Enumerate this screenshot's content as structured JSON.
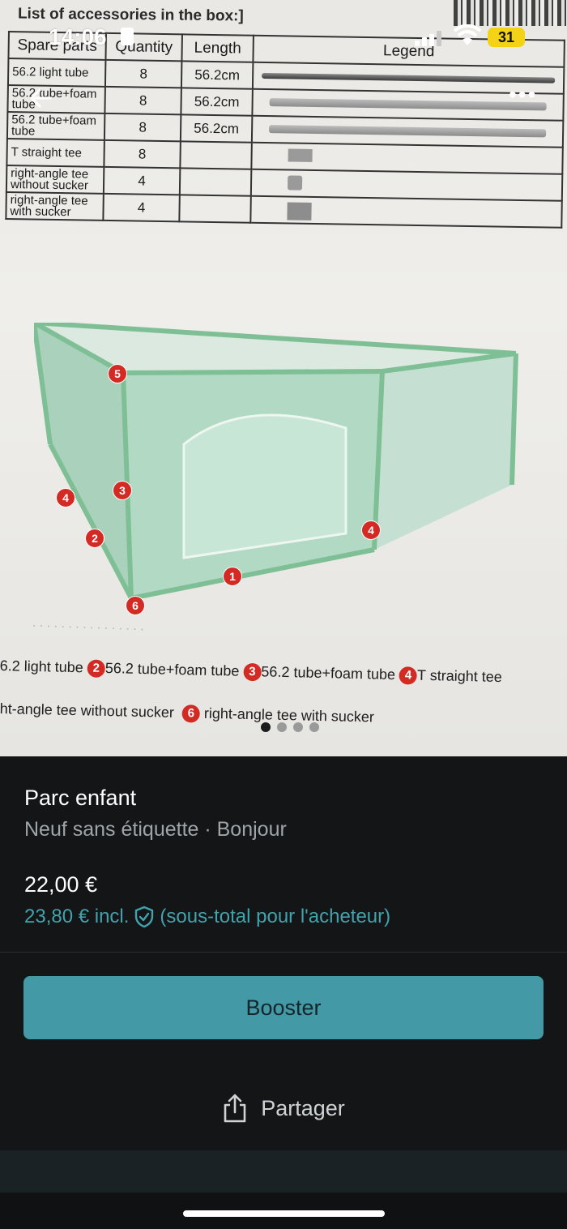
{
  "status_bar": {
    "time": "14:06",
    "battery": "31"
  },
  "photo": {
    "doc_title": "List of accessories in the box:]",
    "table": {
      "headers": [
        "Spare parts",
        "Quantity",
        "Length",
        "Legend"
      ],
      "rows": [
        {
          "part": "56.2 light tube",
          "qty": "8",
          "length": "56.2cm"
        },
        {
          "part": "56.2 tube+foam tube",
          "qty": "8",
          "length": "56.2cm"
        },
        {
          "part": "56.2 tube+foam tube",
          "qty": "8",
          "length": "56.2cm"
        },
        {
          "part": "T straight tee",
          "qty": "8",
          "length": ""
        },
        {
          "part": "right-angle tee without sucker",
          "qty": "4",
          "length": ""
        },
        {
          "part": "right-angle tee with sucker",
          "qty": "4",
          "length": ""
        }
      ]
    },
    "markers": [
      "5",
      "3",
      "4",
      "2",
      "6",
      "1",
      "4"
    ],
    "caption": {
      "line1": {
        "t1": "6.2 light tube",
        "n2": "2",
        "t2": "56.2 tube+foam tube",
        "n3": "3",
        "t3": "56.2 tube+foam tube",
        "n4": "4",
        "t4": "T straight tee"
      },
      "line2": {
        "t5": "ht-angle tee without sucker",
        "n6": "6",
        "t6": "right-angle tee with sucker"
      }
    },
    "carousel": {
      "count": 4,
      "active": 0
    }
  },
  "listing": {
    "title": "Parc enfant",
    "subtitle": "Neuf sans étiquette · Bonjour",
    "price": "22,00 €",
    "price_incl": "23,80 € incl.",
    "price_incl_note": "(sous-total pour l'acheteur)"
  },
  "actions": {
    "booster": "Booster",
    "share": "Partager"
  },
  "colors": {
    "accent": "#4499a7",
    "teal_text": "#42a3ad",
    "marker_red": "#d42a24",
    "background": "#131517"
  },
  "icons": [
    "back-arrow-icon",
    "more-options-icon",
    "shield-check-icon",
    "share-icon"
  ]
}
